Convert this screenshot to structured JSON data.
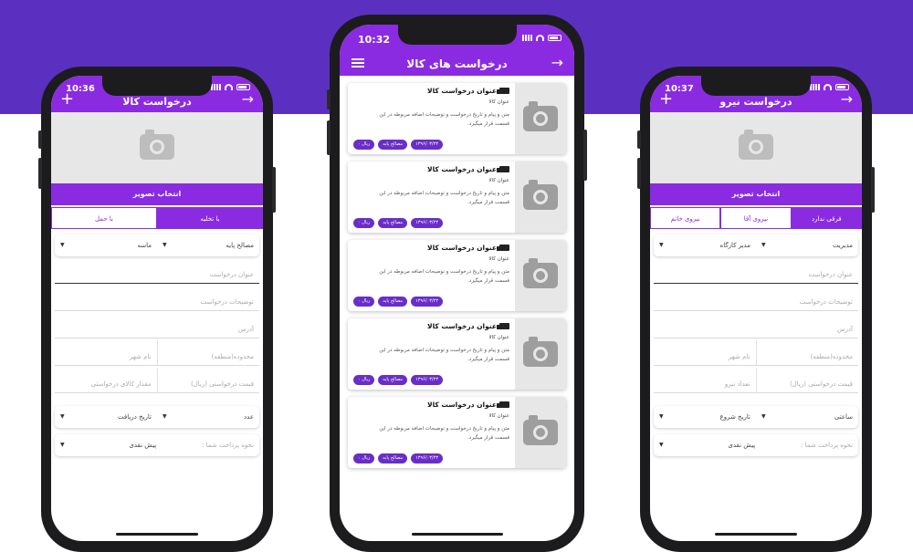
{
  "left": {
    "time": "10:36",
    "title": "درخواست کالا",
    "pick_label": "انتخاب تصویر",
    "tabs": [
      "با حمل",
      "با تخلیه"
    ],
    "material": "مصالح پایه",
    "sub_material": "ماسه",
    "fields": {
      "title": "عنوان درخواست",
      "desc": "توضیحات درخواست",
      "address": "آدرس",
      "region": "محدوده(منطقه)",
      "city": "نام شهر",
      "price": "قیمت درخواستی (ریال)",
      "amount": "مقدار کالای درخواستی"
    },
    "unit": "عدد",
    "receive_date": "تاریخ دریافت",
    "payment_label": "نحوه پرداخت شما :",
    "payment_value": "پیش نقدی"
  },
  "middle": {
    "time": "10:32",
    "title": "درخواست های کالا",
    "cards": [
      {
        "title": "عنوان درخواست کالا",
        "sub": "عنوان کالا",
        "desc": "متن و پیام و تاریخ درخواست و توضیحات اضافه مربوطه در این قسمت قرار میگیرد.",
        "date": "۱۳۹۶/۰۳/۲۳",
        "category": "مصالح پایه",
        "price": "۰ ریال"
      },
      {
        "title": "عنوان درخواست کالا",
        "sub": "عنوان کالا",
        "desc": "متن و پیام و تاریخ درخواست و توضیحات اضافه مربوطه در این قسمت قرار میگیرد.",
        "date": "۱۳۹۶/۰۳/۲۳",
        "category": "مصالح پایه",
        "price": "۰ ریال"
      },
      {
        "title": "عنوان درخواست کالا",
        "sub": "عنوان کالا",
        "desc": "متن و پیام و تاریخ درخواست و توضیحات اضافه مربوطه در این قسمت قرار میگیرد.",
        "date": "۱۳۹۶/۰۳/۲۳",
        "category": "مصالح پایه",
        "price": "۰ ریال"
      },
      {
        "title": "عنوان درخواست کالا",
        "sub": "عنوان کالا",
        "desc": "متن و پیام و تاریخ درخواست و توضیحات اضافه مربوطه در این قسمت قرار میگیرد.",
        "date": "۱۳۹۶/۰۳/۲۳",
        "category": "مصالح پایه",
        "price": "۰ ریال"
      },
      {
        "title": "عنوان درخواست کالا",
        "sub": "عنوان کالا",
        "desc": "متن و پیام و تاریخ درخواست و توضیحات اضافه مربوطه در این قسمت قرار میگیرد.",
        "date": "۱۳۹۶/۰۳/۲۳",
        "category": "مصالح پایه",
        "price": "۰ ریال"
      }
    ]
  },
  "right": {
    "time": "10:37",
    "title": "درخواست نیرو",
    "pick_label": "انتخاب تصویر",
    "tabs": [
      "نیروی خانم",
      "نیروی آقا",
      "فرقی ندارد"
    ],
    "role": "مدیریت",
    "sub_role": "مدیر کارگاه",
    "fields": {
      "title": "عنوان درخواست",
      "desc": "توضیحات درخواست",
      "address": "آدرس",
      "region": "محدوده(منطقه)",
      "city": "نام شهر",
      "price": "قیمت درخواستی (ریال)",
      "count": "تعداد نیرو"
    },
    "rate": "ساعتی",
    "start_date": "تاریخ شروع",
    "payment_label": "نحوه پرداخت شما :",
    "payment_value": "پیش نقدی"
  }
}
